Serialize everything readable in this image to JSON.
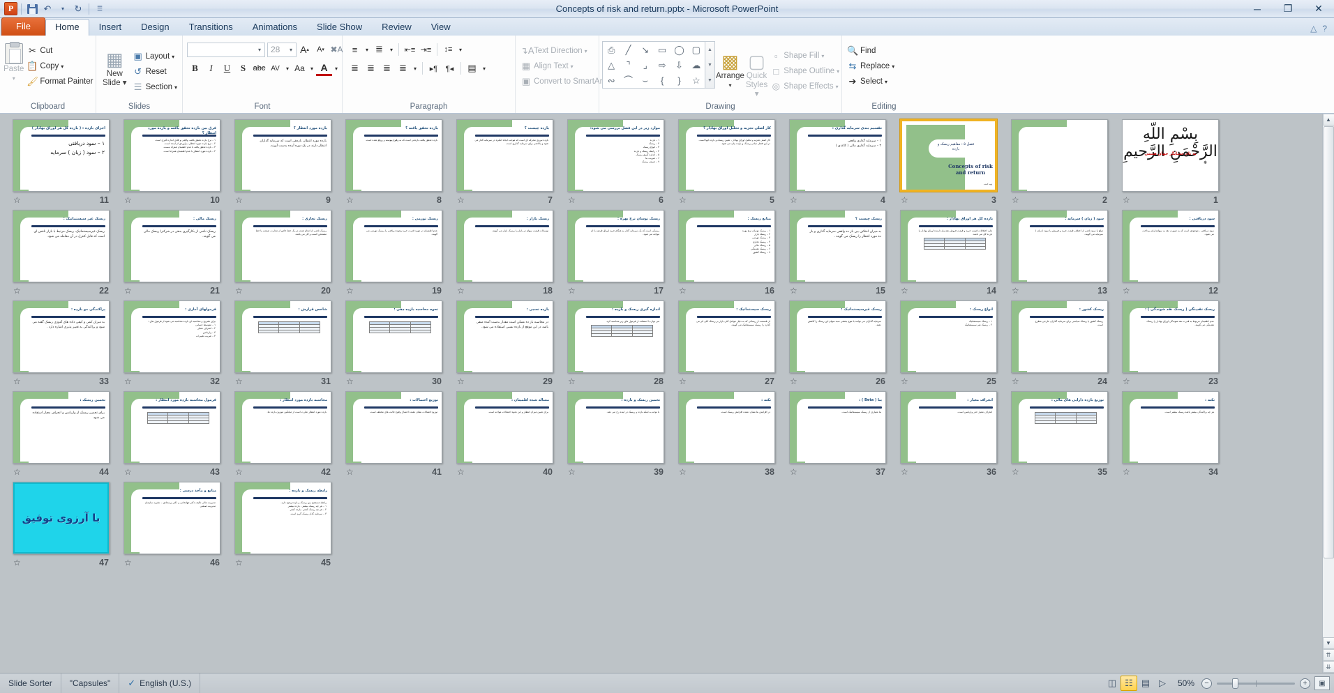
{
  "window": {
    "title": "Concepts of risk and return.pptx  -  Microsoft PowerPoint",
    "app_logo": "P",
    "minimize": "─",
    "restore": "❐",
    "close": "✕"
  },
  "quick_access": {
    "save": "save-icon",
    "undo": "↶",
    "undo_caret": "▾",
    "redo": "↻",
    "customize": "☰"
  },
  "tabs": [
    {
      "label": "File",
      "type": "file"
    },
    {
      "label": "Home",
      "type": "active"
    },
    {
      "label": "Insert",
      "type": "normal"
    },
    {
      "label": "Design",
      "type": "normal"
    },
    {
      "label": "Transitions",
      "type": "normal"
    },
    {
      "label": "Animations",
      "type": "normal"
    },
    {
      "label": "Slide Show",
      "type": "normal"
    },
    {
      "label": "Review",
      "type": "normal"
    },
    {
      "label": "View",
      "type": "normal"
    }
  ],
  "help_buttons": {
    "minimize_ribbon": "△",
    "help": "?"
  },
  "ribbon": {
    "clipboard": {
      "label": "Clipboard",
      "paste": "Paste",
      "paste_caret": "▾",
      "cut": "Cut",
      "copy": "Copy",
      "copy_caret": "▾",
      "format_painter": "Format Painter"
    },
    "slides": {
      "label": "Slides",
      "new_slide": "New\nSlide",
      "new_slide_line1": "New",
      "new_slide_line2": "Slide",
      "layout": "Layout",
      "reset": "Reset",
      "section": "Section"
    },
    "font": {
      "label": "Font",
      "font_name": "",
      "font_name_placeholder": "",
      "font_size": "28",
      "grow_font": "A↑",
      "shrink_font": "A↓",
      "clear_formatting": "Aa",
      "bold": "B",
      "italic": "I",
      "underline": "U",
      "shadow": "S",
      "strikethrough": "abc",
      "character_spacing": "AV",
      "change_case": "Aa",
      "font_color": "A"
    },
    "paragraph": {
      "label": "Paragraph",
      "bullets": "≡",
      "numbering": "≡",
      "decrease_indent": "←≡",
      "increase_indent": "→≡",
      "line_spacing": "↕≡",
      "align_left": "≡",
      "align_center": "≡",
      "align_right": "≡",
      "justify": "≡",
      "ltr_text": "▶¶",
      "rtl_text": "¶◀",
      "columns": "≡≡",
      "text_direction": "Text Direction",
      "align_text": "Align Text",
      "convert_to_smartart": "Convert to SmartArt"
    },
    "drawing": {
      "label": "Drawing",
      "shapes": [
        "text-box",
        "line",
        "arrow",
        "rectangle",
        "oval",
        "rounded-rectangle",
        "triangle",
        "elbow-connector",
        "elbow-arrow-connector",
        "right-arrow",
        "down-arrow",
        "cloud",
        "freeform",
        "curve",
        "arc",
        "left-brace",
        "right-brace",
        "star"
      ],
      "shape_glyphs": [
        "Ὓ9",
        "╲",
        "↘",
        "▭",
        "◯",
        "▢",
        "△",
        "┐",
        "┙",
        "⇨",
        "⇩",
        "☁",
        "∿",
        "⌒",
        "⌣",
        "{",
        "}",
        "☆"
      ],
      "arrange": "Arrange",
      "arrange_caret": "▾",
      "quick_styles_l1": "Quick",
      "quick_styles_l2": "Styles",
      "shape_fill": "Shape Fill",
      "shape_outline": "Shape Outline",
      "shape_effects": "Shape Effects"
    },
    "editing": {
      "label": "Editing",
      "find": "Find",
      "replace": "Replace",
      "select": "Select"
    }
  },
  "sorter": {
    "selected_slide": 3,
    "rows": [
      [
        {
          "n": 11,
          "type": "content",
          "title": "اجزای بازده : ( بازده کل هر اوراق بهادار )",
          "lines": [
            "۱ – سود دریافتی",
            "۲ – سود ( زیان ) سرمایه"
          ],
          "big": true
        },
        {
          "n": 10,
          "type": "content",
          "title": "فرق بین بازده تحقق یافته و بازده مورد انتظار ؟",
          "lines": [
            "۱ – نرخ بازده تحقق یافته، واقعی و قابل اندازه گیری است.",
            "۲ – نرخ بازده مورد انتظار، برآوردی از آینده است.",
            "۳ – بازده تحقق یافته با عدم اطمینان همراه نیست.",
            "۴ – بازده مورد انتظار با عدم اطمینان همراه است."
          ]
        },
        {
          "n": 9,
          "type": "content",
          "title": "بازده مورد انتظار ؟",
          "lines": [
            "بازده مورد انتظار، بازدهی است که سرمایه گذاران انتظار دارند در یک دوره آینده بدست آورند."
          ],
          "mid": true
        },
        {
          "n": 8,
          "type": "content",
          "title": "بازده تحقق یافته ؟",
          "lines": [
            "بازده تحقق یافته، بازدهی است که به وقوع پیوسته و روفع شده است."
          ]
        },
        {
          "n": 7,
          "type": "content",
          "title": "بازده چیست ؟",
          "lines": [
            "بازده نیروی محرکه ای است که موجب ایجاد انگیزه در سرمایه گذار می شود و پاداشی برای سرمایه گذاری است."
          ]
        },
        {
          "n": 6,
          "type": "content",
          "title": "موارد زیر در این فصل بررسی می شود:",
          "lines": [
            "۱ – بازده",
            "۲ – ریسک",
            "۳ – انواع ریسک",
            "۴ – رابطه ریسک و بازده",
            "۵ – اندازه گیری ریسک",
            "۶ – ضریب بتا",
            "۷ – صرف ریسک"
          ]
        },
        {
          "n": 5,
          "type": "content",
          "title": "کار اصلی تجزیه و تحلیل اوراق بهادار ؟",
          "lines": [
            "کار اصلی تجزیه و تحلیل اوراق بهادار ، تعیین ریسک و بازده آنها است.",
            "در این فصل مبانی ریسک و بازده بیان می شود."
          ]
        },
        {
          "n": 4,
          "type": "content",
          "title": "تقسیم بندی سرمایه گذاری :",
          "lines": [
            "۱ – سرمایه گذاری واقعی",
            "۲ – سرمایه گذاری مالی ( کاغذی )"
          ],
          "mid": true
        },
        {
          "n": 3,
          "type": "title",
          "t1": "فصل ۵ : مفاهیم ریسک و بازده",
          "t2": "Concepts of risk and return",
          "t3": "تهیه کننده",
          "selected": true
        },
        {
          "n": 2,
          "type": "content",
          "title": "",
          "lines": [],
          "empty": true
        },
        {
          "n": 1,
          "type": "bism",
          "calli": "بِسْمِ اللّهِ الرَّحْمَنِ الرَّحیمِ",
          "line": "به نام حسابگر جهان هستی"
        }
      ],
      [
        {
          "n": 22,
          "type": "content",
          "title": "ریسک غیر سیستماتیک :",
          "lines": [
            "ریسک غیرسیستماتیک، ریسک مرتبط با بازار ناقص ای است که قابل کنترل در آن معامله می شود."
          ],
          "mid": true
        },
        {
          "n": 21,
          "type": "content",
          "title": "ریسک مالی :",
          "lines": [
            "ریسک ناشی از بکارگیری بدهی در شرکترا ریسک مالی می گویند."
          ],
          "mid": true
        },
        {
          "n": 20,
          "type": "content",
          "title": "ریسک تجاری :",
          "lines": [
            "ریسک ناشی از انجام شدن در یک خط خاص از تجارت، صنعت یا خط مشخص کسب و کار می باشد."
          ]
        },
        {
          "n": 19,
          "type": "content",
          "title": "ریسک تورمی :",
          "lines": [
            "عدم اطمینان در مورد قدرت خرید وجوه دریافتی را ریسک تورمی می گویند."
          ]
        },
        {
          "n": 18,
          "type": "content",
          "title": "ریسک بازار :",
          "lines": [
            "نوسانات قیمت سهام در بازار را ریسک بازار می گویند."
          ]
        },
        {
          "n": 17,
          "type": "content",
          "title": "ریسک نوسان نرخ بهره :",
          "lines": [
            "ریسکی است که یک سرمایه گذار به هنگام خرید اوراق قرضه با آن مواجه می شود."
          ]
        },
        {
          "n": 16,
          "type": "content",
          "title": "منابع ریسک :",
          "lines": [
            "۱ – ریسک نوسان نرخ بهره",
            "۲ – ریسک بازار",
            "۳ – ریسک تورمی",
            "۴ – ریسک تجاری",
            "۵ – ریسک مالی",
            "۶ – ریسک نقدینگی",
            "۷ – ریسک کشور"
          ]
        },
        {
          "n": 15,
          "type": "content",
          "title": "ریسک چیست ؟",
          "lines": [
            "به میزان اختلاف بین باز ده واقعی سرمایه گذاری و باز ده مورد انتظار را ریسک می گویند ."
          ],
          "mid": true
        },
        {
          "n": 14,
          "type": "content",
          "title": "بازده کل هر اوراق بهادار :",
          "lines": [
            "مایه اختلافات قیمت خرید و قیمت فروش نقدساز دارنده اوراق بهادار را بازده کل می نامند."
          ],
          "hastbl": true
        },
        {
          "n": 13,
          "type": "content",
          "title": "سود ( زیان ) سرمایه :",
          "lines": [
            "مبلغ یا سود ناشی از اختلاف قیمت خرید و فروش را سود ( زیان ) سرمایه می گویند."
          ]
        },
        {
          "n": 12,
          "type": "content",
          "title": "سود دریافتی :",
          "lines": [
            "سود دریافتی ، موجودی است که به صورت نقد به سهامداران پرداخت می شود."
          ]
        }
      ],
      [
        {
          "n": 33,
          "type": "content",
          "title": "پراکندگی مو بازده :",
          "lines": [
            "به میزان کمی و کیفی داده های آموزی ریسک گفته می شود و پراکندگی به تغییر پذیری اشاره دارد ."
          ],
          "mid": true
        },
        {
          "n": 32,
          "type": "content",
          "title": "فرمولهای آماری :",
          "lines": [
            "برای تشریح و محاسبه ای بازده محاسبه می شود از فرمول های :",
            "۱ – متوسط حسابی",
            "۲ – انحراف معیار",
            "۳ – واریانس",
            "۴ – ضریب تغییرات"
          ]
        },
        {
          "n": 31,
          "type": "content",
          "title": "شاخص قرارش :",
          "lines": [],
          "hastbl": true
        },
        {
          "n": 30,
          "type": "content",
          "title": "نحوه محاسبه بازده دهی :",
          "lines": [],
          "hastbl": true
        },
        {
          "n": 29,
          "type": "content",
          "title": "بازده نسبی :",
          "lines": [
            "در محاسبه باز ده ممکن است مقدار بدست آمده منفی باشد در این موقع از بازده نسبی استفاده می شود."
          ],
          "mid": true
        },
        {
          "n": 28,
          "type": "content",
          "title": "اندازه گیری ریسک و بازده :",
          "lines": [
            "می توان با استفاده از فرمول های زیر محاسبه کرد."
          ],
          "hastbl": true
        },
        {
          "n": 27,
          "type": "content",
          "title": "ریسک سیستماتیک :",
          "lines": [
            "آن قسمت از ریسکی که به دلیل عوامل کلی بازار بر ریسک کلی اثر می گذارد را ریسک سیستماتیک می گویند."
          ]
        },
        {
          "n": 26,
          "type": "content",
          "title": "ریسک غیرسیستماتیک :",
          "lines": [
            "سرمایه گذاران می توانند با تنوع بخشی سبد سهام این ریسک را کاهش دهند."
          ]
        },
        {
          "n": 25,
          "type": "content",
          "title": "انواع ریسک :",
          "lines": [
            "۱ – ریسک سیستماتیک",
            "۲ – ریسک غیر سیستماتیک"
          ]
        },
        {
          "n": 24,
          "type": "content",
          "title": "ریسک کشور :",
          "lines": [
            "ریسک کشور یا ریسک سیاسی برای سرمایه گذاران خارجی مطرح است."
          ]
        },
        {
          "n": 23,
          "type": "content",
          "title": "ریسک نقدینگی ( ریسک نقد شوندگی ) :",
          "lines": [
            "عدم اطمینان مربوط به قدرت نقد شوندگی اوراق بهادار را ریسک نقدینگی می گویند."
          ]
        }
      ],
      [
        {
          "n": 44,
          "type": "content",
          "title": "تخمین ریسک :",
          "lines": [
            "برای تخمین ریسک از واریانس و انحراف معیار استفاده می شود."
          ],
          "mid": true
        },
        {
          "n": 43,
          "type": "content",
          "title": "فرمول محاسبه بازده مورد انتظار :",
          "lines": [],
          "hastbl": true
        },
        {
          "n": 42,
          "type": "content",
          "title": "محاسبه بازده مورد انتظار :",
          "lines": [
            "بازده مورد انتظار عبارت است از میانگین موزون بازده ها."
          ]
        },
        {
          "n": 41,
          "type": "content",
          "title": "توزیع احتمالات :",
          "lines": [
            "توزیع احتمالات نشان دهنده احتمال وقوع حالت های مختلف است."
          ]
        },
        {
          "n": 40,
          "type": "content",
          "title": "مساله شده اطمینان :",
          "lines": [
            "برای تعیین میزان انتظار و این نحوه احتمالات مواجه است."
          ]
        },
        {
          "n": 39,
          "type": "content",
          "title": "تخمین ریسک و بازده :",
          "lines": [
            "با توجه به اینکه بازده و ریسک در آینده رخ می دهد."
          ]
        },
        {
          "n": 38,
          "type": "content",
          "title": "نکته :",
          "lines": [
            "در افزایش بتا نشان دهنده افزایش ریسک است."
          ]
        },
        {
          "n": 37,
          "type": "content",
          "title": "بتا ( Beta ) :",
          "lines": [
            "بتا معیاری از ریسک سیستماتیک است."
          ]
        },
        {
          "n": 36,
          "type": "content",
          "title": "انحراف معیار :",
          "lines": [
            "انحراف معیار جذر واریانس است."
          ]
        },
        {
          "n": 35,
          "type": "content",
          "title": "توزیع بازده دارایی های مالی :",
          "lines": [],
          "hastbl": true
        },
        {
          "n": 34,
          "type": "content",
          "title": "نکته :",
          "lines": [
            "هر چه پراکندگی بیشتر باشد ریسک بیشتر است."
          ]
        }
      ],
      [
        {
          "n": 47,
          "type": "cyan",
          "text": "با آرزوی توفیق"
        },
        {
          "n": 46,
          "type": "content",
          "title": "منابع و مآخذ درسی :",
          "lines": [
            "مدیریت مالی تألیف دکتر جهانخانی و دکتر پرسعادی – نشریه سازمان مدیریت صنعتی"
          ]
        },
        {
          "n": 45,
          "type": "content",
          "title": "رابطه ریسک و بازده :",
          "lines": [
            "رابطه مستقیم بین ریسک و بازده وجود دارد.",
            "۱ – هر چه ریسک بیشتر ، بازده بیشتر",
            "۲ – هر چه ریسک کمتر ، بازده کمتر",
            "۳ – سرمایه گذار ریسک گریز است."
          ]
        }
      ]
    ]
  },
  "statusbar": {
    "view_name": "Slide Sorter",
    "theme": "\"Capsules\"",
    "spellcheck_icon": "spell-check-icon",
    "language": "English (U.S.)",
    "view_buttons": [
      {
        "name": "normal-view",
        "glyph": "◫",
        "active": false
      },
      {
        "name": "slide-sorter-view",
        "glyph": "☷",
        "active": true
      },
      {
        "name": "reading-view",
        "glyph": "▤",
        "active": false
      },
      {
        "name": "slide-show-view",
        "glyph": "▷",
        "active": false
      }
    ],
    "zoom_percent": "50%",
    "zoom_out": "−",
    "zoom_in": "+",
    "fit_to_window": "fit-slide-icon"
  },
  "scrollbar": {
    "up_arrow": "▲",
    "down_arrow": "▼",
    "prev_slide": "⇈",
    "next_slide": "⇊"
  }
}
